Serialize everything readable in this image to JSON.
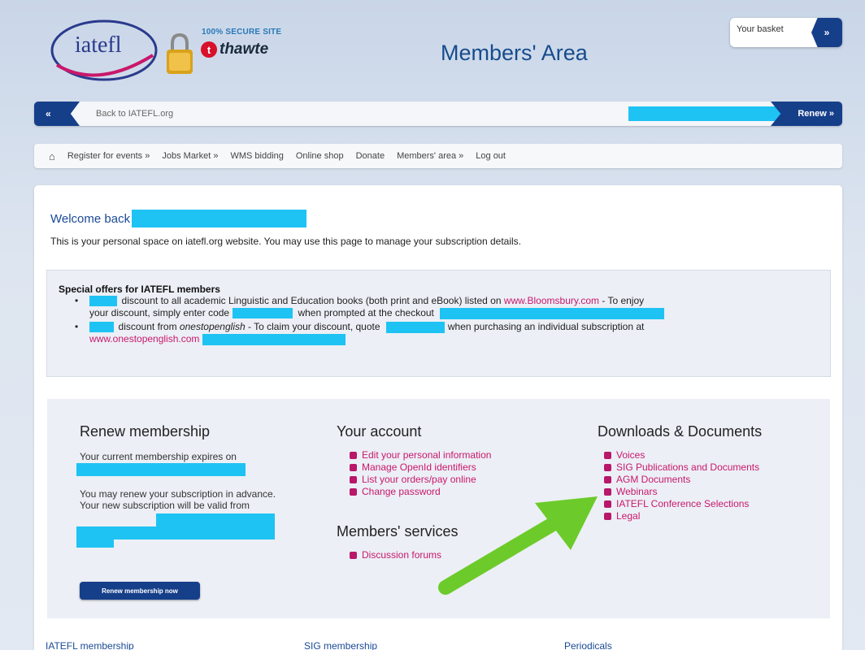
{
  "header": {
    "logo_text": "iatefl",
    "secure_site": "100% SECURE SITE",
    "thawte_text": "thawte",
    "title": "Members' Area",
    "basket_label": "Your basket",
    "basket_arrow": "»"
  },
  "backbar": {
    "back_arrow": "«",
    "back_text": "Back to IATEFL.org",
    "renew_label": "Renew »"
  },
  "nav": {
    "home_icon": "⌂",
    "items": [
      "Register for events »",
      "Jobs Market »",
      "WMS bidding",
      "Online shop",
      "Donate",
      "Members' area »",
      "Log out"
    ]
  },
  "welcome": {
    "title": "Welcome back",
    "intro": "This is your personal space on iatefl.org website. You may use this page to manage your subscription details."
  },
  "offers": {
    "title": "Special offers for IATEFL members",
    "offer1_text_a": "discount to all academic Linguistic and Education books (both print and eBook) listed on",
    "offer1_link": "www.Bloomsbury.com",
    "offer1_text_b": "- To enjoy",
    "offer1_text_c": "your discount, simply enter code",
    "offer1_text_d": "when prompted at the checkout",
    "offer2_text_a": "discount from",
    "offer2_italic": "onestopenglish",
    "offer2_text_b": "- To claim your discount, quote",
    "offer2_text_c": "when purchasing an individual subscription at",
    "offer2_link": "www.onestopenglish.com"
  },
  "renew": {
    "heading": "Renew membership",
    "expires": "Your current membership expires on",
    "advance": "You may renew your subscription in advance. Your new subscription will be valid from",
    "button": "Renew membership now"
  },
  "account": {
    "heading": "Your account",
    "links": [
      "Edit your personal information",
      "Manage OpenId identifiers",
      "List your orders/pay online",
      "Change password"
    ]
  },
  "services": {
    "heading": "Members' services",
    "links": [
      "Discussion forums"
    ]
  },
  "downloads": {
    "heading": "Downloads & Documents",
    "links": [
      "Voices",
      "SIG Publications and Documents",
      "AGM Documents",
      "Webinars",
      "IATEFL Conference Selections",
      "Legal"
    ]
  },
  "bottom": {
    "links": [
      "IATEFL membership",
      "SIG membership",
      "Periodicals"
    ]
  },
  "colors": {
    "accent_blue": "#163f8a",
    "link_pink": "#c8186c",
    "redaction": "#1ec3f3",
    "annotation_arrow": "#6ccb2a"
  }
}
